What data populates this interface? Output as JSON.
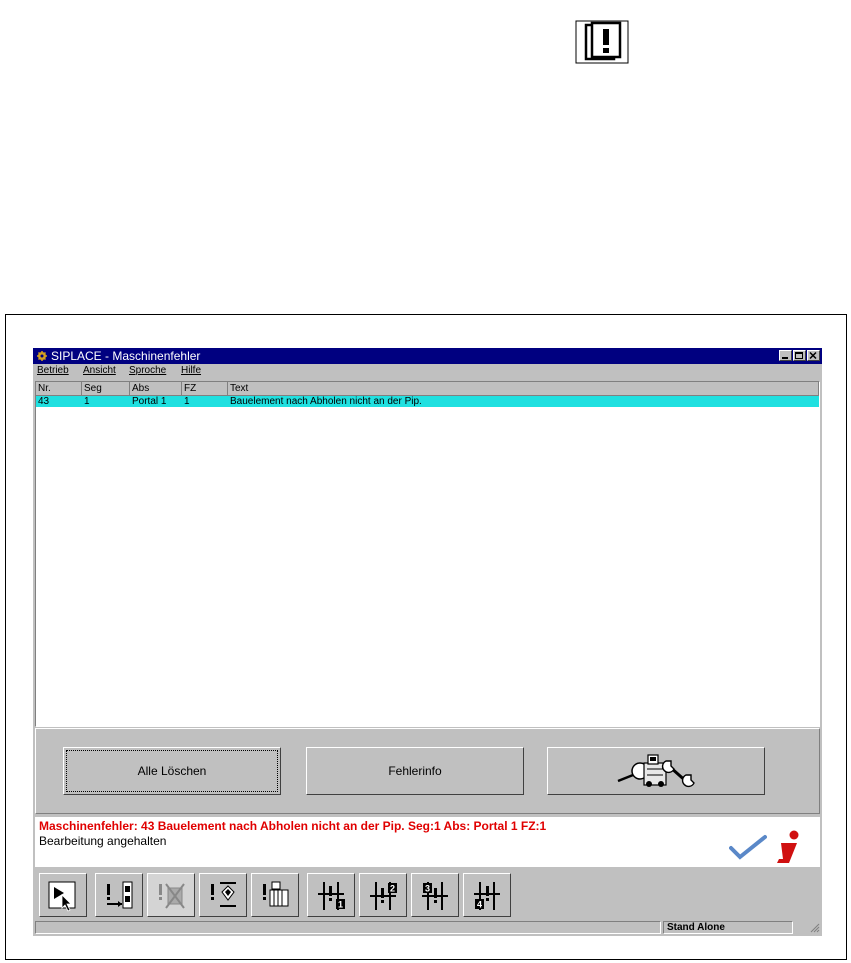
{
  "window": {
    "title": "SIPLACE - Maschinenfehler"
  },
  "menu": [
    "Betrieb",
    "Ansicht",
    "Sproche",
    "Hilfe"
  ],
  "table": {
    "columns": [
      "Nr.",
      "Seg",
      "Abs",
      "FZ",
      "Text"
    ],
    "rows": [
      [
        "43",
        "1",
        "Portal 1",
        "1",
        "Bauelement nach Abholen nicht an der Pip."
      ]
    ]
  },
  "buttons": {
    "clear_all": "Alle Löschen",
    "error_info": "Fehlerinfo",
    "service_icon": "machine-service-icon"
  },
  "messages": {
    "error": "Maschinenfehler: 43  Bauelement nach Abholen nicht an der Pip.  Seg:1  Abs: Portal 1  FZ:1",
    "state": "Bearbeitung angehalten"
  },
  "toolbar": [
    "select-pointer-icon",
    "error-feeder-icon",
    "error-component-icon",
    "error-nozzle-icon",
    "error-machine-icon",
    "segment-1-icon",
    "segment-2-icon",
    "segment-3-icon",
    "segment-4-icon"
  ],
  "statusbar": {
    "mode": "Stand Alone"
  },
  "colors": {
    "titlebar": "#000080",
    "selected_row": "#20e0e0",
    "error_text": "#e00000",
    "window_bg": "#c0c0c0"
  }
}
